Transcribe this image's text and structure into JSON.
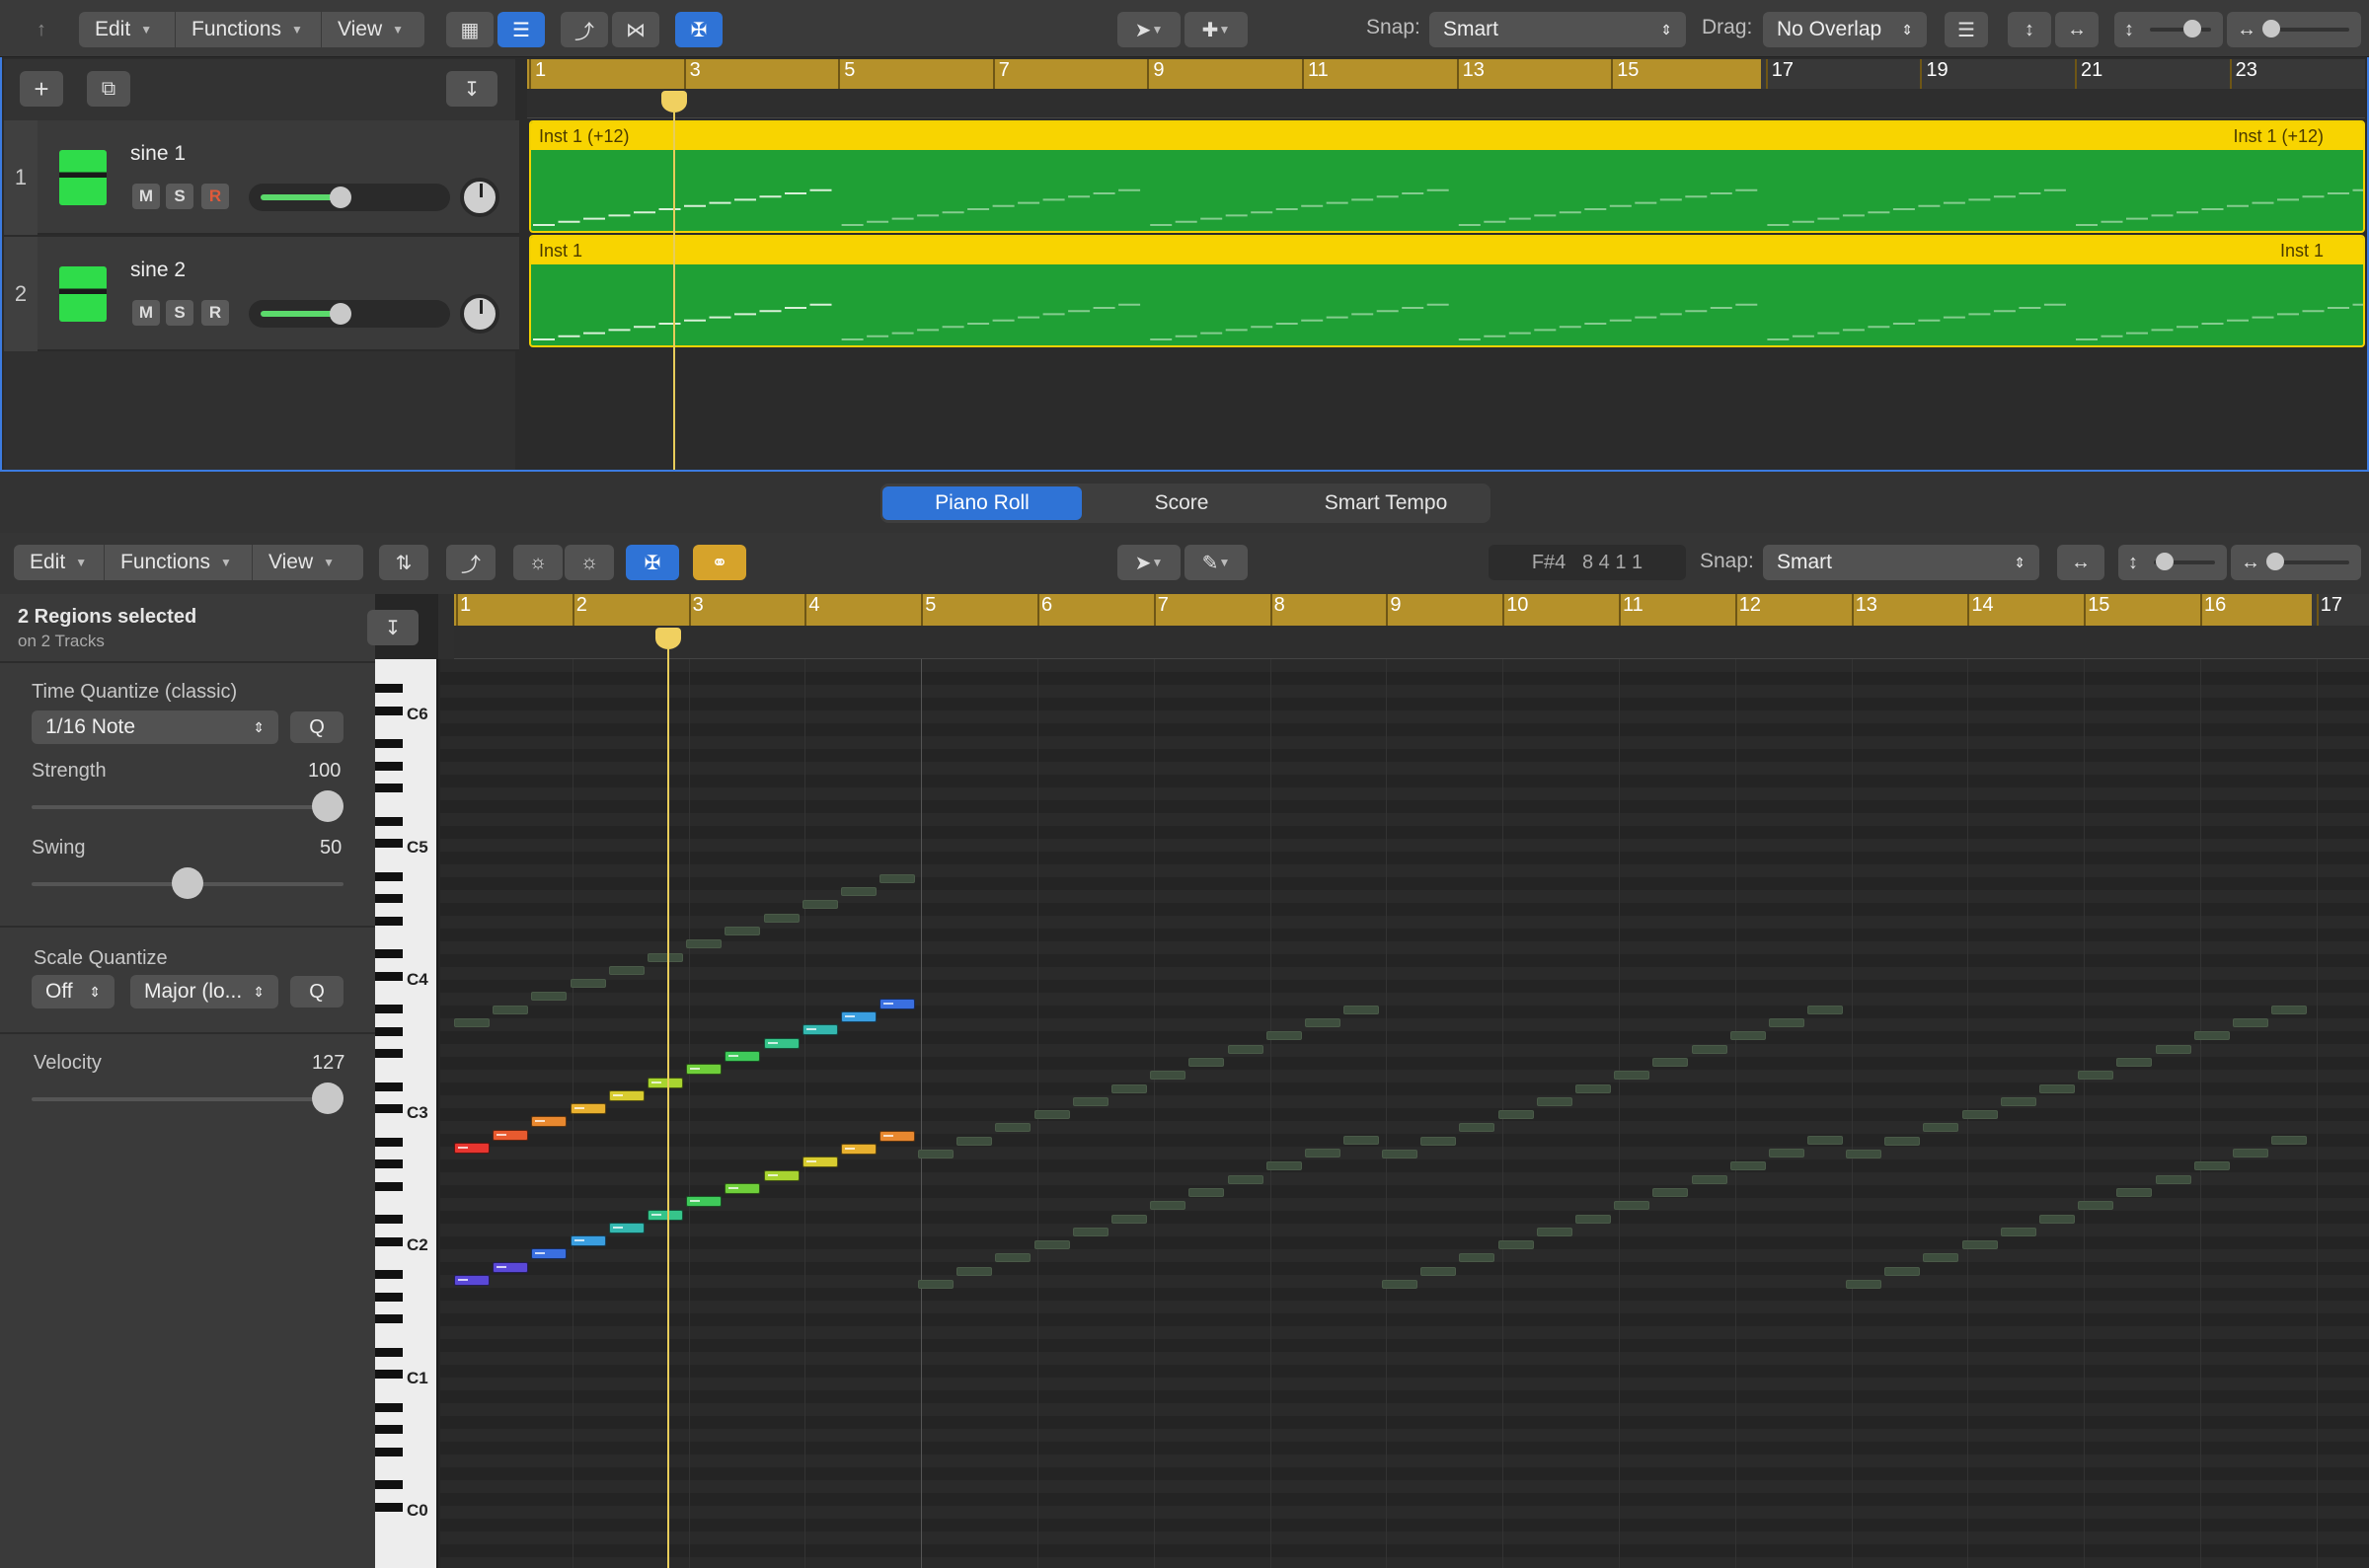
{
  "toolbar_top": {
    "edit": "Edit",
    "functions": "Functions",
    "view": "View",
    "snap_label": "Snap:",
    "snap_value": "Smart",
    "drag_label": "Drag:",
    "drag_value": "No Overlap"
  },
  "tracks_ruler": [
    "1",
    "3",
    "5",
    "7",
    "9",
    "11",
    "13",
    "15",
    "17",
    "19",
    "21",
    "23"
  ],
  "tracks": [
    {
      "number": "1",
      "name": "sine 1",
      "mute": "M",
      "solo": "S",
      "record": "R",
      "volume_level": 0.28,
      "region_label": "Inst 1 (+12)",
      "region_label_end": "Inst 1 (+12)"
    },
    {
      "number": "2",
      "name": "sine 2",
      "mute": "M",
      "solo": "S",
      "record": "R",
      "volume_level": 0.28,
      "region_label": "Inst 1",
      "region_label_end": "Inst 1"
    }
  ],
  "editor_tabs": [
    "Piano Roll",
    "Score",
    "Smart Tempo"
  ],
  "editor_toolbar": {
    "edit": "Edit",
    "functions": "Functions",
    "view": "View",
    "position": "F#4   8 4 1 1",
    "snap_label": "Snap:",
    "snap_value": "Smart"
  },
  "inspector": {
    "regions_selected": "2 Regions selected",
    "regions_sub": "on 2 Tracks",
    "time_quantize_label": "Time Quantize (classic)",
    "time_quantize_value": "1/16 Note",
    "q": "Q",
    "strength_label": "Strength",
    "strength_value": "100",
    "swing_label": "Swing",
    "swing_value": "50",
    "scale_quantize_label": "Scale Quantize",
    "scale_off": "Off",
    "scale_mode": "Major (lo...",
    "velocity_label": "Velocity",
    "velocity_value": "127"
  },
  "piano_ruler": [
    "1",
    "2",
    "3",
    "4",
    "5",
    "6",
    "7",
    "8",
    "9",
    "10",
    "11",
    "12",
    "13",
    "14",
    "15",
    "16",
    "17"
  ],
  "piano_labels": [
    "C6",
    "C5",
    "C4",
    "C3",
    "C2",
    "C1",
    "C0"
  ],
  "colors": {
    "accent": "#2f73d6",
    "region": "#1fa035",
    "region_header": "#f8d400",
    "ruler": "#b5912a",
    "playhead": "#f0d060"
  }
}
